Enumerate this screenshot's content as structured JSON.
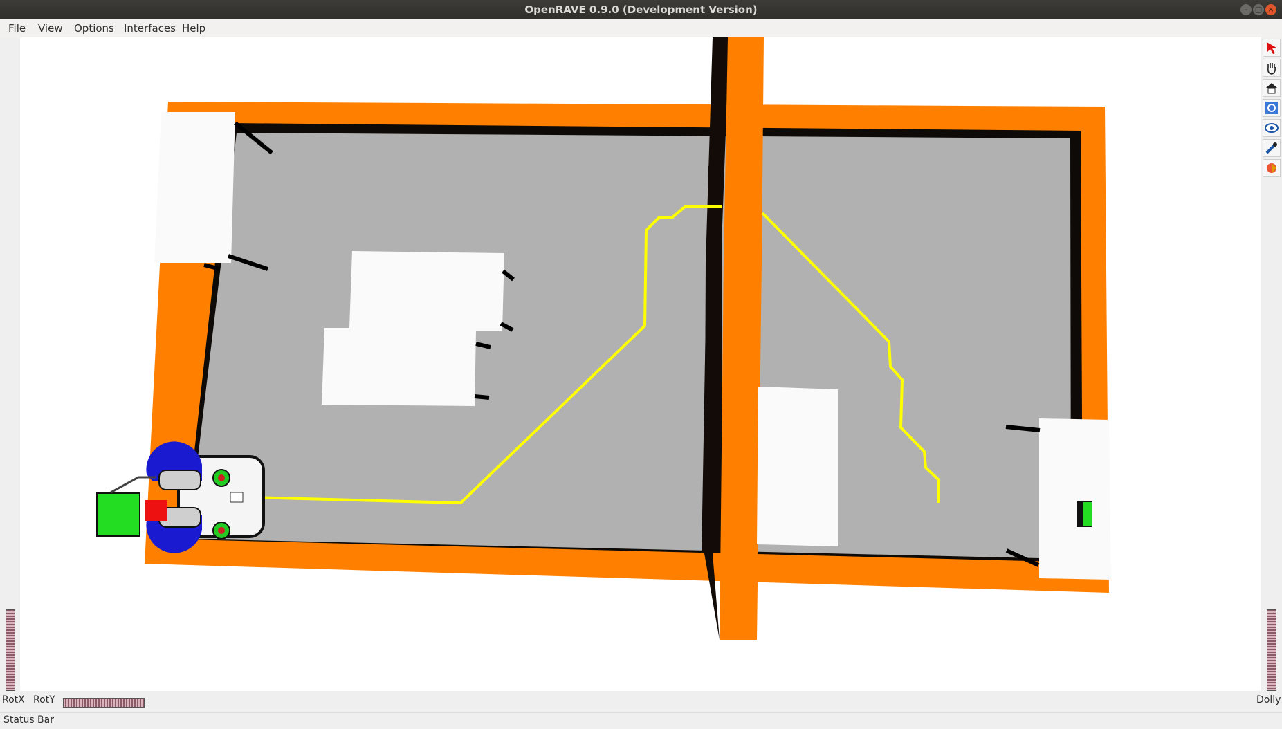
{
  "window": {
    "title": "OpenRAVE 0.9.0 (Development Version)"
  },
  "menu": {
    "items": [
      "File",
      "View",
      "Options",
      "Interfaces",
      "Help"
    ]
  },
  "toolbar": {
    "icons": [
      "select-arrow-icon",
      "pan-hand-icon",
      "home-view-icon",
      "seek-icon",
      "view-all-icon",
      "pick-tool-icon",
      "collision-icon"
    ]
  },
  "bottom": {
    "rotx": "RotX",
    "roty": "RotY",
    "dolly": "Dolly"
  },
  "status": {
    "text": "Status Bar"
  },
  "colors": {
    "wall": "#ff8000",
    "floor": "#b1b1b1",
    "path": "#ffff00",
    "background": "#ffffff"
  }
}
